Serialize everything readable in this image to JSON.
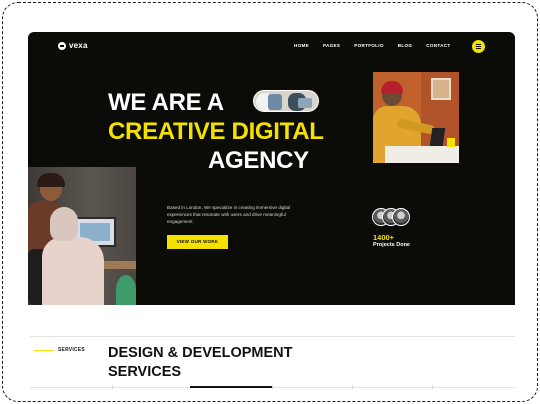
{
  "brand": {
    "name": "vexa"
  },
  "nav": {
    "items": [
      "HOME",
      "PAGES",
      "PORTFOLIO",
      "BLOG",
      "CONTACT"
    ],
    "menu_icon": "hamburger-icon",
    "accent_color": "#f5e100"
  },
  "hero": {
    "line1": "WE ARE A",
    "line2": "CREATIVE DIGITAL",
    "line3": "AGENCY",
    "intro": "Based in London, We specialize in creating immersive digital experiences that resonate with users and drive meaningful engagement.",
    "cta_label": "VIEW OUR WORK"
  },
  "stats": {
    "projects_value": "1400+",
    "projects_label": "Projects Done"
  },
  "services": {
    "eyebrow": "SERVICES",
    "title": "DESIGN & DEVELOPMENT SERVICES"
  },
  "colors": {
    "hero_bg": "#0b0b08",
    "accent": "#f5e100",
    "text_light": "#ffffff"
  }
}
